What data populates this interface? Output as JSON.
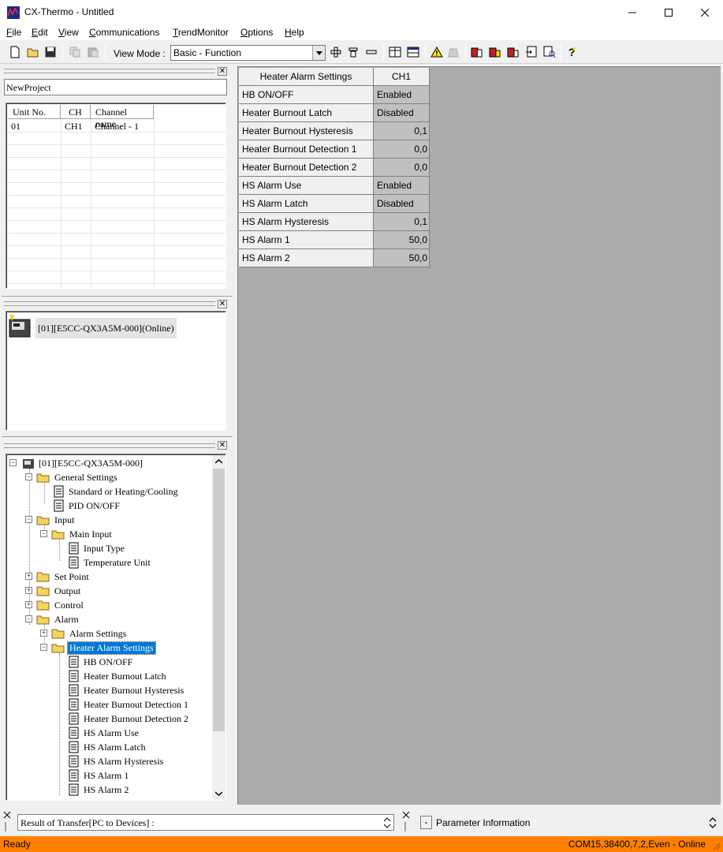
{
  "window": {
    "title": "CX-Thermo - Untitled",
    "controls": {
      "minimize": "minimize-icon",
      "maximize": "maximize-icon",
      "close": "close-icon"
    }
  },
  "menubar": {
    "items": [
      {
        "label": "File",
        "hotkey": "F"
      },
      {
        "label": "Edit",
        "hotkey": "E"
      },
      {
        "label": "View",
        "hotkey": "V"
      },
      {
        "label": "Communications",
        "hotkey": "C"
      },
      {
        "label": "TrendMonitor",
        "hotkey": "T"
      },
      {
        "label": "Options",
        "hotkey": "O"
      },
      {
        "label": "Help",
        "hotkey": "H"
      }
    ]
  },
  "toolbar": {
    "view_mode_label": "View Mode :",
    "view_mode_value": "Basic - Function",
    "icons": [
      "new-file-icon",
      "open-folder-icon",
      "save-icon",
      "copy-icon",
      "paste-icon",
      "add-device-icon",
      "filter-icon",
      "remove-icon",
      "compare-icon",
      "grid-view-icon",
      "alert-icon",
      "mute-alert-icon",
      "transfer-to-device-icon",
      "transfer-from-device-icon",
      "compare-device-icon",
      "transfer-settings-icon",
      "search-device-icon",
      "help-icon"
    ]
  },
  "project_panel": {
    "name": "NewProject"
  },
  "unit_table": {
    "headers": [
      "Unit No.",
      "CH",
      "Channel name"
    ],
    "rows": [
      {
        "unit": "01",
        "ch": "CH1",
        "name": "Channel - 1"
      }
    ]
  },
  "device_panel": {
    "device_label": "[01][E5CC-QX3A5M-000](Online)"
  },
  "tree": {
    "root": "[01][E5CC-QX3A5M-000]",
    "nodes": [
      "General Settings",
      "Standard or Heating/Cooling",
      "PID ON/OFF",
      "Input",
      "Main Input",
      "Input Type",
      "Temperature Unit",
      "Set Point",
      "Output",
      "Control",
      "Alarm",
      "Alarm Settings",
      "Heater Alarm Settings",
      "HB ON/OFF",
      "Heater Burnout Latch",
      "Heater Burnout Hysteresis",
      "Heater Burnout Detection 1",
      "Heater Burnout Detection 2",
      "HS Alarm Use",
      "HS Alarm Latch",
      "HS Alarm Hysteresis",
      "HS Alarm 1",
      "HS Alarm 2"
    ]
  },
  "param_grid": {
    "title": "Heater Alarm Settings",
    "channel": "CH1",
    "rows": [
      {
        "name": "HB ON/OFF",
        "value": "Enabled",
        "numeric": false
      },
      {
        "name": "Heater Burnout Latch",
        "value": "Disabled",
        "numeric": false
      },
      {
        "name": "Heater Burnout Hysteresis",
        "value": "0,1",
        "numeric": true
      },
      {
        "name": "Heater Burnout Detection 1",
        "value": "0,0",
        "numeric": true
      },
      {
        "name": "Heater Burnout Detection 2",
        "value": "0,0",
        "numeric": true
      },
      {
        "name": "HS Alarm Use",
        "value": "Enabled",
        "numeric": false
      },
      {
        "name": "HS Alarm Latch",
        "value": "Disabled",
        "numeric": false
      },
      {
        "name": "HS Alarm Hysteresis",
        "value": "0,1",
        "numeric": true
      },
      {
        "name": "HS Alarm 1",
        "value": "50,0",
        "numeric": true
      },
      {
        "name": "HS Alarm 2",
        "value": "50,0",
        "numeric": true
      }
    ]
  },
  "bottom": {
    "transfer_result": "Result of Transfer[PC to Devices] :",
    "param_info_toggle": "-",
    "param_info_label": "Parameter Information"
  },
  "status": {
    "left": "Ready",
    "right": "COM15,38400,7,2,Even - Online",
    "color": "#ff8000"
  }
}
